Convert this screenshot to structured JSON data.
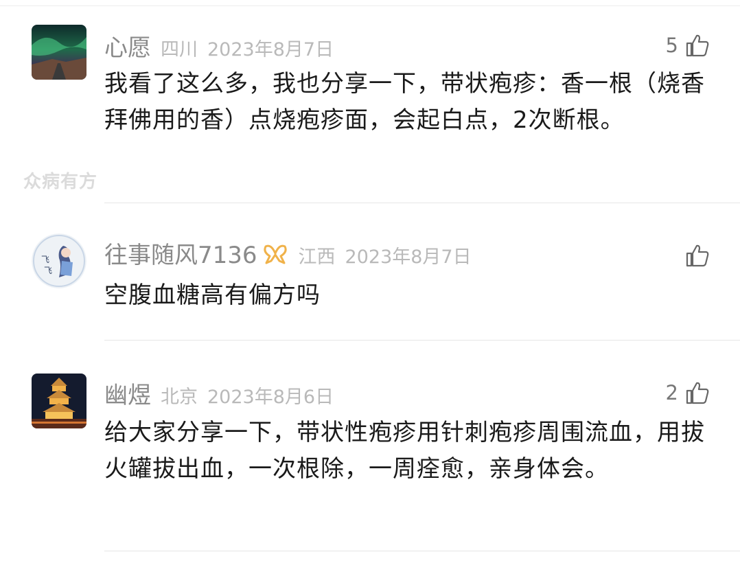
{
  "comments": [
    {
      "username": "心愿",
      "location": "四川",
      "date": "2023年8月7日",
      "likes": "5",
      "text": "我看了这么多，我也分享一下，带状疱疹：香一根（烧香拜佛用的香）点烧疱疹面，会起白点，2次断根。",
      "avatar_icon": "aurora-landscape-avatar"
    },
    {
      "username": "往事随风7136",
      "location": "江西",
      "date": "2023年8月7日",
      "likes": "",
      "text": "空腹血糖高有偏方吗",
      "avatar_icon": "anime-girl-avatar",
      "badge_icon": "vip-ribbon-icon"
    },
    {
      "username": "幽煜",
      "location": "北京",
      "date": "2023年8月6日",
      "likes": "2",
      "text": "给大家分享一下，带状性疱疹用针刺疱疹周围流血，用拔火罐拔出血，一次根除，一周痊愈，亲身体会。",
      "avatar_icon": "pagoda-night-avatar"
    }
  ],
  "watermark": "众病有方",
  "colors": {
    "username": "#8a8a8a",
    "meta": "#b9b9b9",
    "body_text": "#1a1a1a",
    "badge": "#f0b24a",
    "divider": "#e6e6e6"
  }
}
